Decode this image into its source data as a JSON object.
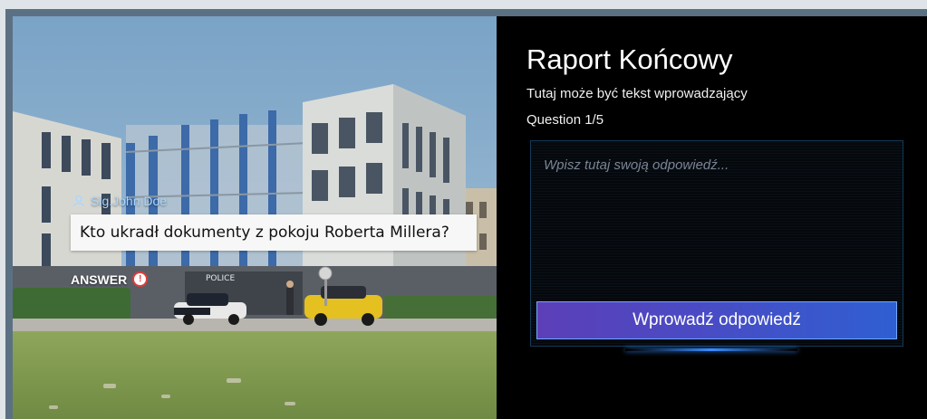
{
  "scene": {
    "speaker_name": "Sig.John Doe",
    "question": "Kto ukradł dokumenty z pokoju Roberta Millera?",
    "answer_label": "ANSWER",
    "building_sign": "POLICE"
  },
  "panel": {
    "title": "Raport Końcowy",
    "intro": "Tutaj może być tekst wprowadzający",
    "counter": "Question 1/5",
    "answer_placeholder": "Wpisz tutaj swoją odpowiedź...",
    "submit_label": "Wprowadź odpowiedź"
  },
  "icons": {
    "speaker": "user-icon",
    "answer": "alert-icon"
  },
  "colors": {
    "button_start": "#5c3fb8",
    "button_end": "#2f5fd2",
    "speaker_text": "#a9d8ff",
    "panel_bg": "#000000"
  }
}
